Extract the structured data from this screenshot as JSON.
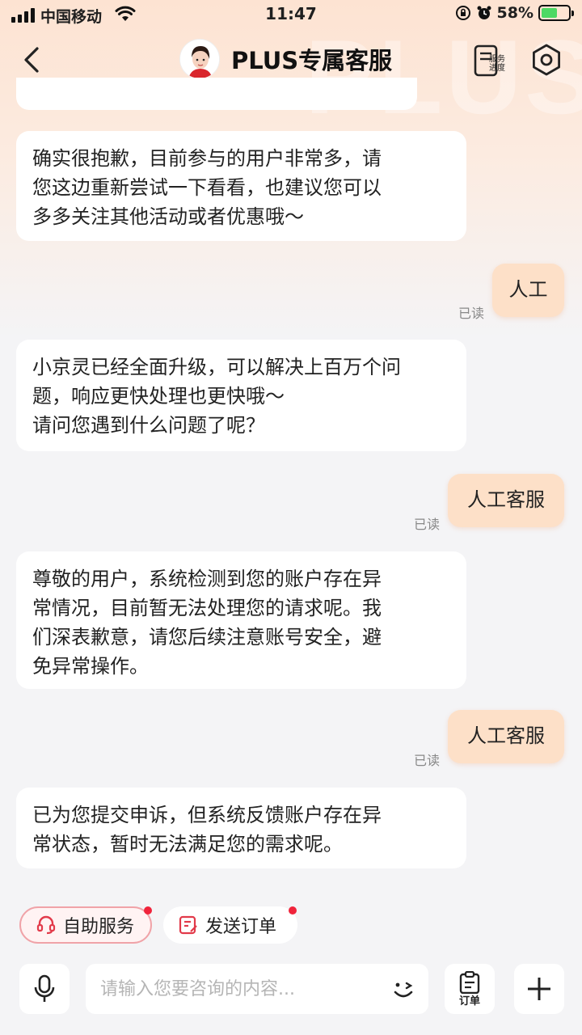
{
  "status_bar": {
    "carrier": "中国移动",
    "time": "11:47",
    "battery": "58%"
  },
  "nav": {
    "title": "PLUS专属客服",
    "progress_label_line1": "服务",
    "progress_label_line2": "进度"
  },
  "watermark": "PLUS",
  "messages": [
    {
      "role": "agent",
      "text": "确实很抱歉，目前参与的用户非常多，请\n您这边重新尝试一下看看，也建议您可以\n多多关注其他活动或者优惠哦～"
    },
    {
      "role": "user",
      "text": "人工",
      "status": "已读"
    },
    {
      "role": "agent",
      "text": "小京灵已经全面升级，可以解决上百万个问\n题，响应更快处理也更快哦～\n请问您遇到什么问题了呢？"
    },
    {
      "role": "user",
      "text": "人工客服",
      "status": "已读"
    },
    {
      "role": "agent",
      "text": "尊敬的用户，系统检测到您的账户存在异\n常情况，目前暂无法处理您的请求呢。我\n们深表歉意，请您后续注意账号安全，避\n免异常操作。"
    },
    {
      "role": "user",
      "text": "人工客服",
      "status": "已读"
    },
    {
      "role": "agent",
      "text": "已为您提交申诉，但系统反馈账户存在异\n常状态，暂时无法满足您的需求呢。"
    }
  ],
  "quick_actions": {
    "self_service": "自助服务",
    "send_order": "发送订单"
  },
  "input": {
    "placeholder": "请输入您要咨询的内容...",
    "value": "",
    "order_label": "订单"
  },
  "colors": {
    "accent_red": "#f0233b",
    "user_bubble": "#fde0c8",
    "header_gradient": "#fde3d2"
  }
}
